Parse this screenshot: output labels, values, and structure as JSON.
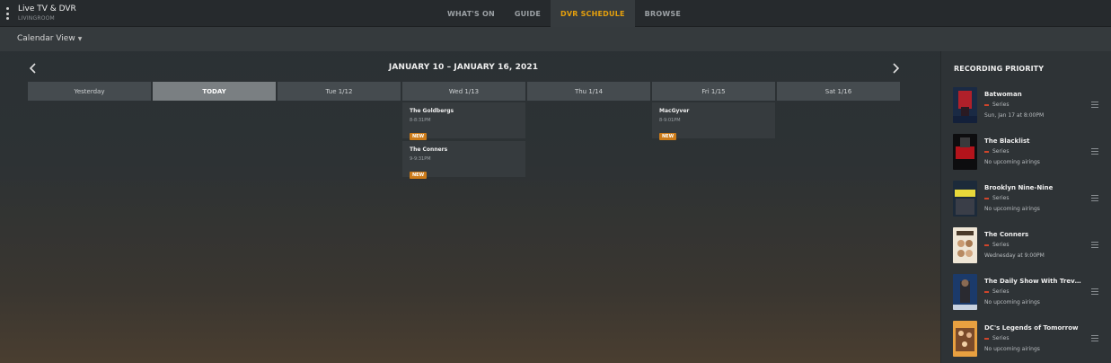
{
  "app": {
    "title": "Live TV & DVR",
    "subtitle": "LIVINGROOM"
  },
  "nav": [
    {
      "label": "WHAT'S ON",
      "active": false
    },
    {
      "label": "GUIDE",
      "active": false
    },
    {
      "label": "DVR SCHEDULE",
      "active": true
    },
    {
      "label": "BROWSE",
      "active": false
    }
  ],
  "view": {
    "label": "Calendar View"
  },
  "calendar": {
    "range": "JANUARY 10 – JANUARY 16, 2021",
    "days": [
      "Yesterday",
      "TODAY",
      "Tue 1/12",
      "Wed 1/13",
      "Thu 1/14",
      "Fri 1/15",
      "Sat 1/16"
    ],
    "recordings": {
      "wed": [
        {
          "title": "The Goldbergs",
          "time": "8-8:31PM",
          "badge": "NEW"
        },
        {
          "title": "The Conners",
          "time": "9-9:31PM",
          "badge": "NEW"
        }
      ],
      "fri": [
        {
          "title": "MacGyver",
          "time": "8-9:01PM",
          "badge": "NEW"
        }
      ]
    }
  },
  "priority": {
    "title": "RECORDING PRIORITY",
    "items": [
      {
        "name": "Batwoman",
        "type": "Series",
        "airing": "Sun, Jan 17 at 8:00PM"
      },
      {
        "name": "The Blacklist",
        "type": "Series",
        "airing": "No upcoming airings"
      },
      {
        "name": "Brooklyn Nine-Nine",
        "type": "Series",
        "airing": "No upcoming airings"
      },
      {
        "name": "The Conners",
        "type": "Series",
        "airing": "Wednesday at 9:00PM"
      },
      {
        "name": "The Daily Show With Trevor N...",
        "type": "Series",
        "airing": "No upcoming airings"
      },
      {
        "name": "DC's Legends of Tomorrow",
        "type": "Series",
        "airing": "No upcoming airings"
      }
    ]
  },
  "colors": {
    "accent": "#e5a00d",
    "badge": "#cc7b19",
    "record": "#d0452b"
  }
}
